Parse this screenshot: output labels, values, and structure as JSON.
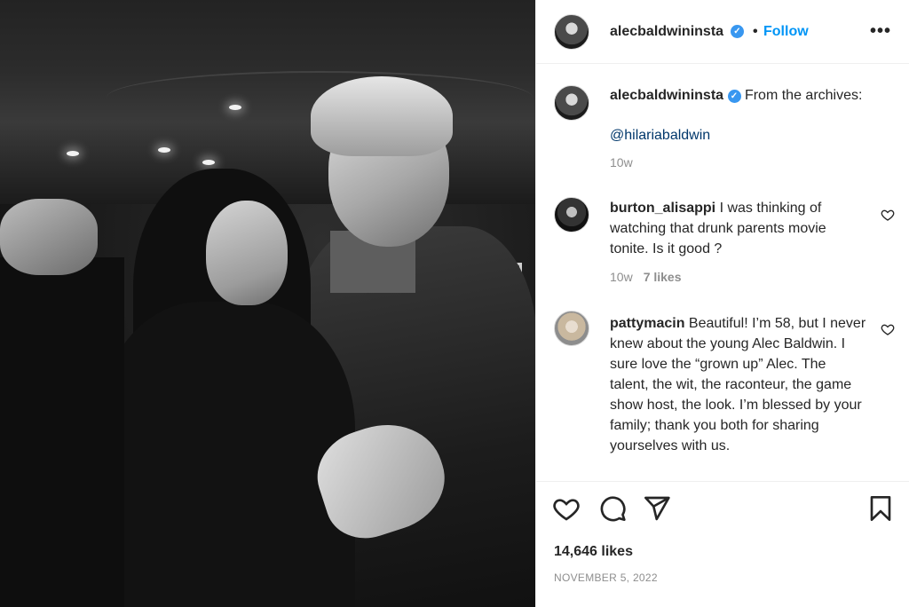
{
  "post": {
    "author": "alecbaldwininsta",
    "follow_label": "Follow",
    "separator": "•",
    "more_label": "•••",
    "caption": {
      "user": "alecbaldwininsta",
      "text": "From the archives:",
      "mention": "@hilariabaldwin",
      "time": "10w"
    },
    "comments": [
      {
        "user": "burton_alisappi",
        "text": "I was thinking of watching that drunk parents movie tonite. Is it good ?",
        "time": "10w",
        "likes": "7 likes"
      },
      {
        "user": "pattymacin",
        "text": "Beautiful! I’m 58, but I never knew about the young Alec Baldwin. I sure love the “grown up” Alec. The talent, the wit, the raconteur, the game show host, the look. I’m blessed by your family; thank you both for sharing yourselves with us."
      }
    ],
    "likes_count": "14,646 likes",
    "date": "NOVEMBER 5, 2022"
  },
  "icons": {
    "verified": "verified-badge-icon",
    "like": "heart-icon",
    "comment": "comment-icon",
    "share": "paper-plane-icon",
    "save": "bookmark-icon",
    "more": "more-options-icon"
  },
  "colors": {
    "accent": "#0095f6",
    "verified": "#3897f0",
    "muted": "#8e8e8e",
    "text": "#262626",
    "mention": "#00376b"
  }
}
